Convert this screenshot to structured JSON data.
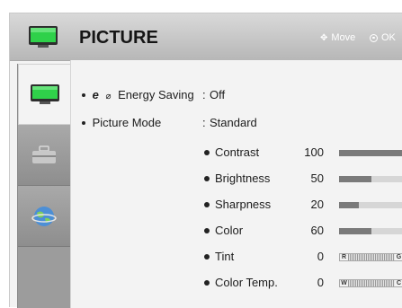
{
  "header": {
    "title": "PICTURE",
    "move_hint": "Move",
    "ok_hint": "OK"
  },
  "sidebar": {
    "tabs": [
      {
        "icon": "tv-icon",
        "active": true
      },
      {
        "icon": "toolbox-icon",
        "active": false
      },
      {
        "icon": "globe-icon",
        "active": false
      }
    ]
  },
  "settings": {
    "energy_saving": {
      "label": "Energy Saving",
      "eco": "e",
      "separator": ":",
      "value": "Off"
    },
    "picture_mode": {
      "label": "Picture Mode",
      "separator": ":",
      "value": "Standard"
    }
  },
  "adjustments": [
    {
      "label": "Contrast",
      "value": "100",
      "level": 1.0
    },
    {
      "label": "Brightness",
      "value": "50",
      "level": 0.5
    },
    {
      "label": "Sharpness",
      "value": "20",
      "level": 0.3
    },
    {
      "label": "Color",
      "value": "60",
      "level": 0.5
    },
    {
      "label": "Tint",
      "value": "0",
      "scale_left": "R",
      "scale_right": "G"
    },
    {
      "label": "Color Temp.",
      "value": "0",
      "scale_left": "W",
      "scale_right": "C"
    }
  ],
  "colors": {
    "header_bg": "#c4c4c4",
    "sidebar_bg": "#9c9c9c",
    "tv_green": "#28c43c",
    "bar_fill": "#7a7a7a"
  }
}
